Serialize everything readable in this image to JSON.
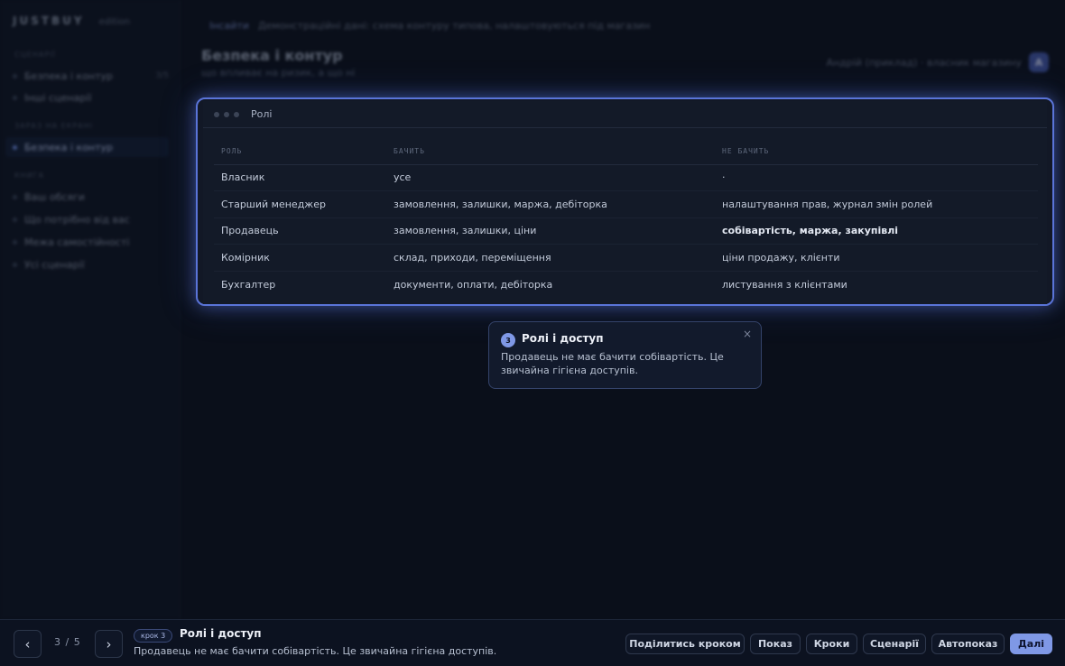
{
  "app": {
    "brand": "JUSTBUY",
    "mode": "edition"
  },
  "sidebar": {
    "section1": "СЦЕНАРІЇ",
    "section2": "ЗАРАЗ НА ЕКРАНІ",
    "section3": "КНИГА",
    "items": [
      {
        "label": "Безпека і контур",
        "count": "3/5"
      },
      {
        "label": "Інші сценарії"
      },
      {
        "label": "Безпека і контур"
      },
      {
        "label": "Ваш обсяги"
      },
      {
        "label": "Що потрібно від вас"
      },
      {
        "label": "Межа самостійності"
      },
      {
        "label": "Усі сценарії"
      }
    ]
  },
  "topbar": {
    "crumb": "Інсайти",
    "text": "Демонстраційні дані: схема контуру типова, налаштовуються під магазин"
  },
  "page": {
    "title": "Безпека і контур",
    "subtitle": "що впливає на ризик, а що ні"
  },
  "user": {
    "text": "Андрій (приклад) · власник магазину",
    "initial": "А"
  },
  "card": {
    "title": "Ролі",
    "headers": [
      "РОЛЬ",
      "БАЧИТЬ",
      "НЕ БАЧИТЬ"
    ],
    "rows": [
      {
        "role": "Власник",
        "sees": "усе",
        "not_sees": "·"
      },
      {
        "role": "Старший менеджер",
        "sees": "замовлення, залишки, маржа, дебіторка",
        "not_sees": "налаштування прав, журнал змін ролей"
      },
      {
        "role": "Продавець",
        "sees": "замовлення, залишки, ціни",
        "not_sees": "собівартість, маржа, закупівлі"
      },
      {
        "role": "Комірник",
        "sees": "склад, приходи, переміщення",
        "not_sees": "ціни продажу, клієнти"
      },
      {
        "role": "Бухгалтер",
        "sees": "документи, оплати, дебіторка",
        "not_sees": "листування з клієнтами"
      }
    ]
  },
  "popover": {
    "number": "3",
    "title": "Ролі і доступ",
    "body": "Продавець не має бачити собівартість. Це звичайна гігієна доступів.",
    "close": "×"
  },
  "tourbar": {
    "prev": "‹",
    "next": "›",
    "counter": "3 / 5",
    "badge": "крок 3",
    "title": "Ролі і доступ",
    "desc": "Продавець не має бачити собівартість. Це звичайна гігієна доступів.",
    "buttons": {
      "share": "Поділитись кроком",
      "show": "Показ",
      "steps": "Кроки",
      "scenarios": "Сценарії",
      "autoshow": "Автопоказ",
      "next": "Далі"
    }
  }
}
